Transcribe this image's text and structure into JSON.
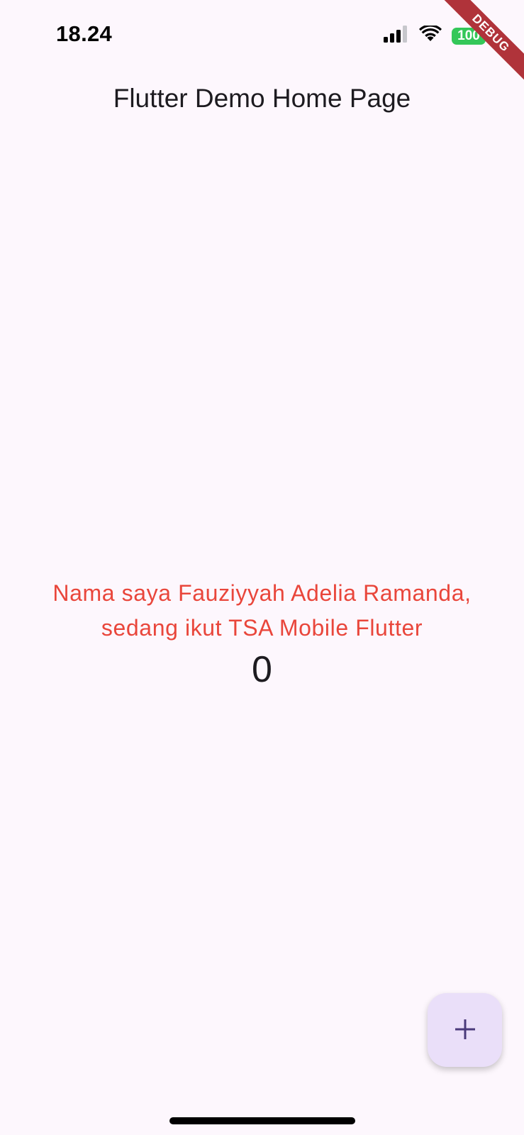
{
  "status_bar": {
    "time": "18.24",
    "battery": "100",
    "icons": [
      "signal-icon",
      "wifi-icon",
      "battery-icon"
    ],
    "battery_color": "#34c759"
  },
  "debug_banner": {
    "label": "DEBUG",
    "color": "#b0333a"
  },
  "app_bar": {
    "title": "Flutter Demo Home Page"
  },
  "body": {
    "message": "Nama saya Fauziyyah Adelia Ramanda, sedang ikut TSA Mobile Flutter",
    "message_color": "#e9463b",
    "counter": "0"
  },
  "fab": {
    "icon": "plus-icon",
    "color": "#eadff9"
  },
  "colors": {
    "background": "#fdf7fd",
    "text": "#1d1b20",
    "accent": "#4a3a7a"
  }
}
